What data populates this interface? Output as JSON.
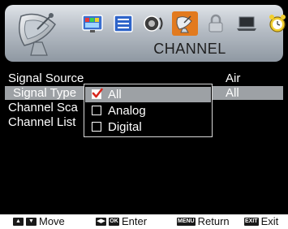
{
  "header": {
    "title": "CHANNEL",
    "menu_icons": [
      "picture-icon",
      "sound-icon",
      "speaker-icon",
      "channel-antenna-icon",
      "lock-icon",
      "laptop-icon",
      "clock-icon"
    ],
    "active_icon_index": 3,
    "accent_color": "#e27a1e"
  },
  "menu": {
    "items": [
      {
        "label": "Signal Source",
        "value": "Air"
      },
      {
        "label": "Signal Type",
        "value": "All"
      },
      {
        "label": "Channel Sca",
        "value": ""
      },
      {
        "label": "Channel List",
        "value": ""
      }
    ],
    "selected_index": 1
  },
  "dropdown": {
    "options": [
      {
        "label": "All",
        "checked": true
      },
      {
        "label": "Analog",
        "checked": false
      },
      {
        "label": "Digital",
        "checked": false
      }
    ]
  },
  "footer": {
    "move": "Move",
    "enter": "Enter",
    "return": "Return",
    "exit": "Exit",
    "ok_key": "OK",
    "menu_key": "MENU",
    "exit_key": "EXIT"
  }
}
